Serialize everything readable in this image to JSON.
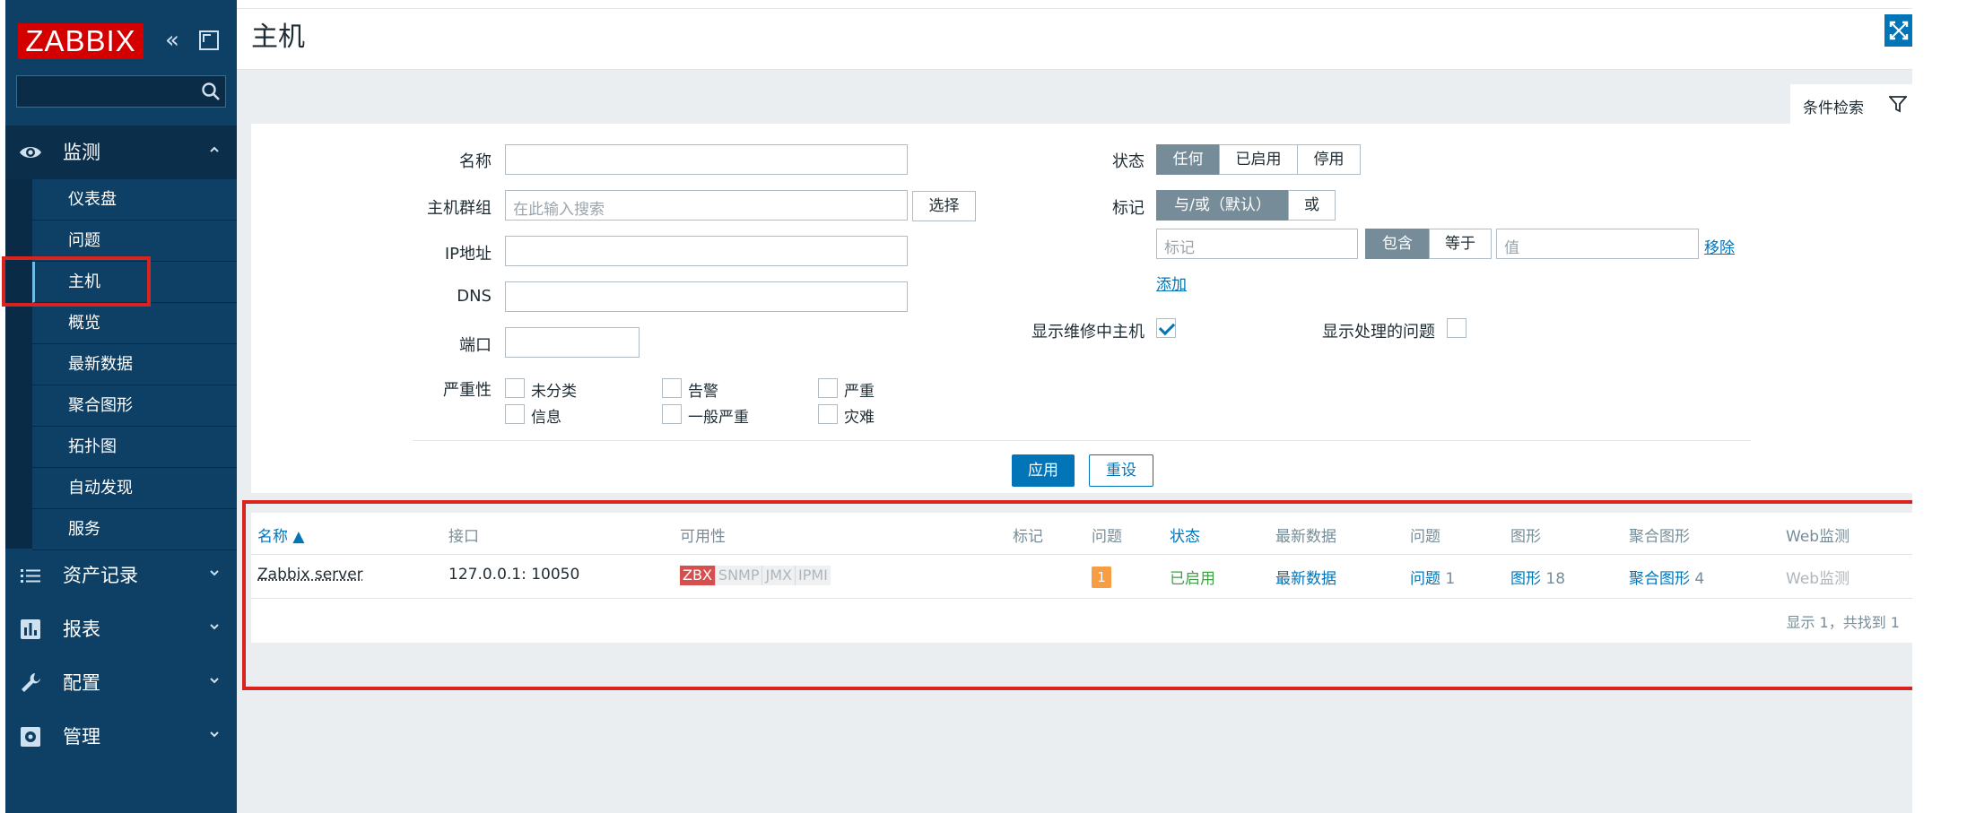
{
  "app": {
    "logo": "ZABBIX",
    "colors": {
      "sidebar": "#0e4066",
      "accent": "#0275b8",
      "highlight": "#d9231f"
    }
  },
  "sidebar": {
    "search_placeholder": "",
    "sections": [
      {
        "label": "监测",
        "icon": "eye-icon",
        "expanded": true
      },
      {
        "label": "资产记录",
        "icon": "list-icon"
      },
      {
        "label": "报表",
        "icon": "bar-chart-icon"
      },
      {
        "label": "配置",
        "icon": "wrench-icon"
      },
      {
        "label": "管理",
        "icon": "gear-icon"
      }
    ],
    "monitor_items": [
      "仪表盘",
      "问题",
      "主机",
      "概览",
      "最新数据",
      "聚合图形",
      "拓扑图",
      "自动发现",
      "服务"
    ],
    "active_item": "主机"
  },
  "header": {
    "title": "主机"
  },
  "filter": {
    "tab_label": "条件检索",
    "name_label": "名称",
    "hostgroup_label": "主机群组",
    "hostgroup_placeholder": "在此输入搜索",
    "select_button": "选择",
    "ip_label": "IP地址",
    "dns_label": "DNS",
    "port_label": "端口",
    "severity_label": "严重性",
    "severities": [
      "未分类",
      "告警",
      "严重",
      "信息",
      "一般严重",
      "灾难"
    ],
    "status_label": "状态",
    "status_options": [
      "任何",
      "已启用",
      "停用"
    ],
    "status_selected": "任何",
    "tags_label": "标记",
    "tag_mode_options": [
      "与/或（默认）",
      "或"
    ],
    "tag_mode_selected": "与/或（默认）",
    "tag_placeholder": "标记",
    "tag_op_options": [
      "包含",
      "等于"
    ],
    "tag_op_selected": "包含",
    "value_placeholder": "值",
    "remove_link": "移除",
    "add_link": "添加",
    "show_maintenance_label": "显示维修中主机",
    "show_maintenance_checked": true,
    "show_suppressed_label": "显示处理的问题",
    "show_suppressed_checked": false,
    "apply_button": "应用",
    "reset_button": "重设"
  },
  "table": {
    "headers": [
      "名称 ▲",
      "接口",
      "可用性",
      "标记",
      "问题",
      "状态",
      "最新数据",
      "问题",
      "图形",
      "聚合图形",
      "Web监测"
    ],
    "rows": [
      {
        "name": "Zabbix server",
        "interface": "127.0.0.1: 10050",
        "availability": [
          "ZBX",
          "SNMP",
          "JMX",
          "IPMI"
        ],
        "tags": "",
        "problems_badge": "1",
        "status": "已启用",
        "latest_data": "最新数据",
        "problems_link": "问题",
        "problems_count": "1",
        "graphs_link": "图形",
        "graphs_count": "18",
        "screens_link": "聚合图形",
        "screens_count": "4",
        "web": "Web监测"
      }
    ],
    "footer": "显示 1，共找到 1"
  }
}
